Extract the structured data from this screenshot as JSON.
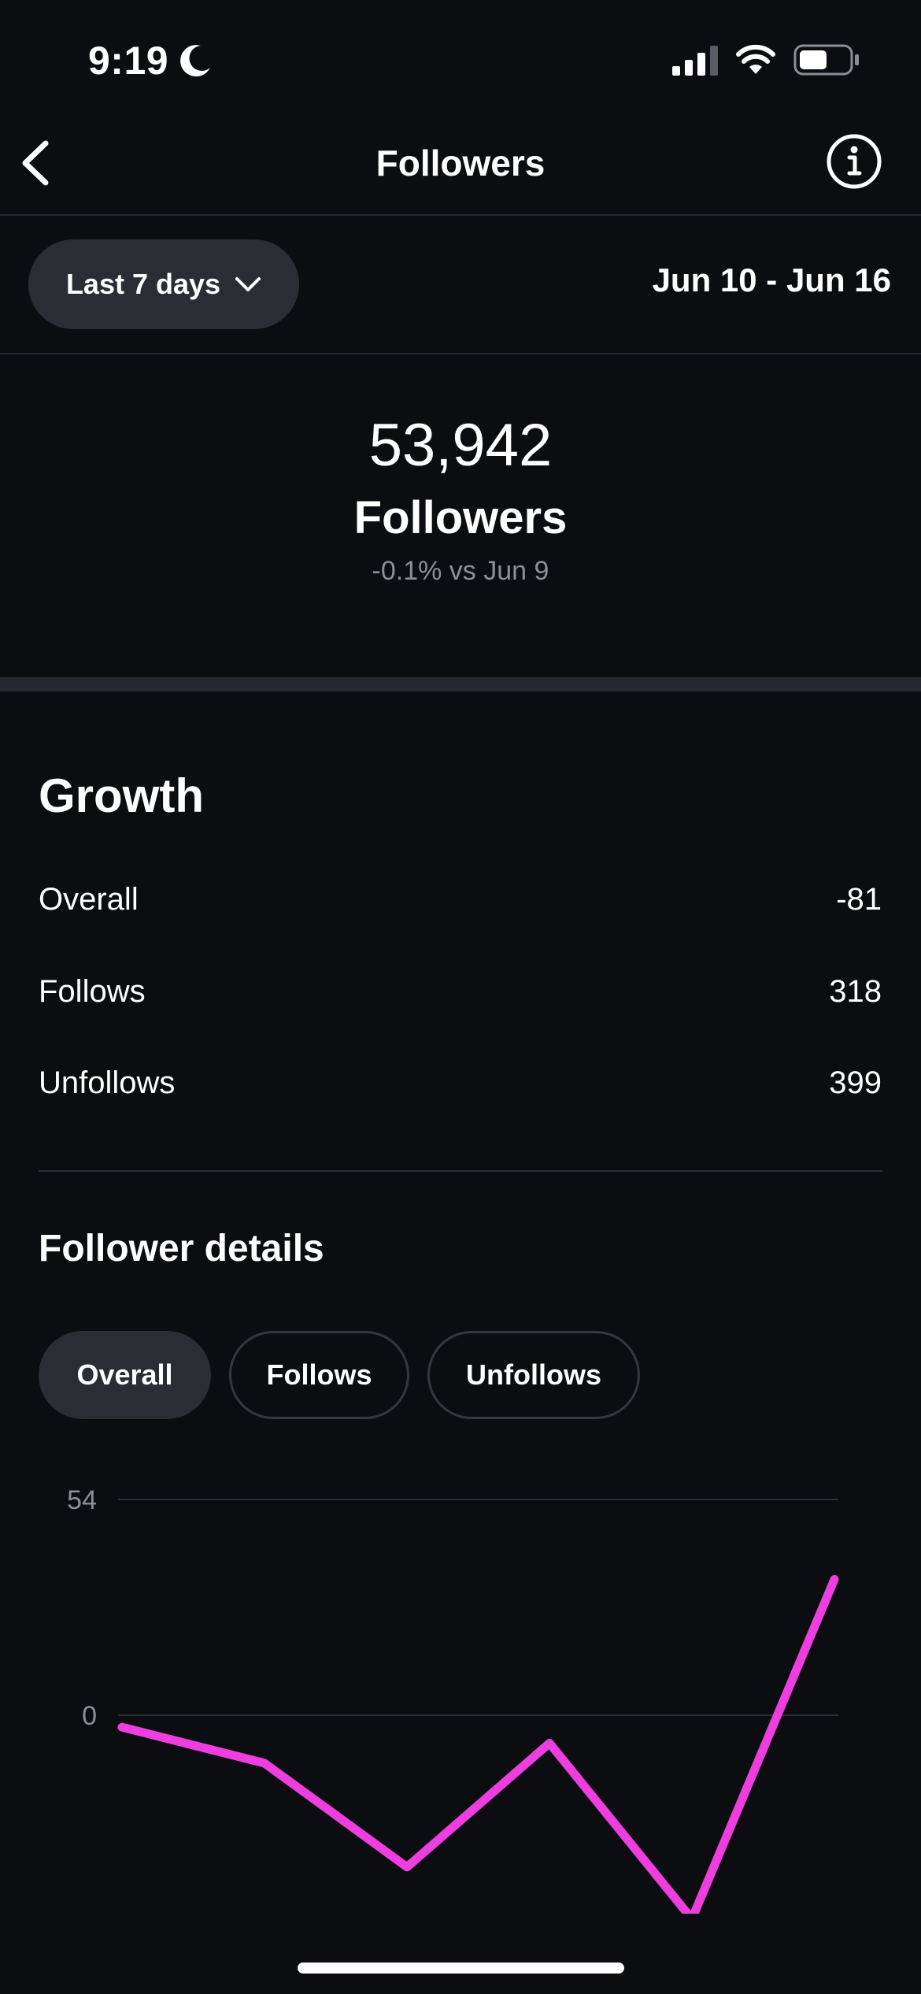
{
  "status_bar": {
    "time": "9:19"
  },
  "nav": {
    "title": "Followers"
  },
  "range": {
    "label": "Last 7 days",
    "dates": "Jun 10 - Jun 16"
  },
  "summary": {
    "count": "53,942",
    "label": "Followers",
    "delta": "-0.1% vs Jun 9"
  },
  "growth": {
    "title": "Growth",
    "rows": [
      {
        "label": "Overall",
        "value": "-81"
      },
      {
        "label": "Follows",
        "value": "318"
      },
      {
        "label": "Unfollows",
        "value": "399"
      }
    ]
  },
  "details": {
    "title": "Follower details",
    "tabs": [
      {
        "label": "Overall",
        "active": true
      },
      {
        "label": "Follows",
        "active": false
      },
      {
        "label": "Unfollows",
        "active": false
      }
    ]
  },
  "colors": {
    "accent_line": "#ef3ee0",
    "background": "#0b0d11"
  },
  "chart_data": {
    "type": "line",
    "x": [
      1,
      2,
      3,
      4,
      5,
      6
    ],
    "values": [
      -3,
      -12,
      -38,
      -7,
      -51,
      34
    ],
    "y_ticks": [
      "54",
      "0"
    ],
    "ylim": [
      -54,
      54
    ],
    "grid": true
  }
}
